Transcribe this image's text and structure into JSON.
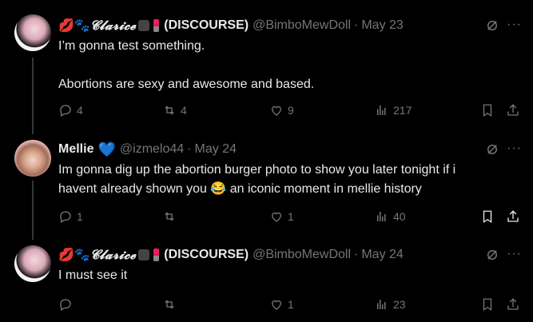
{
  "tweets": [
    {
      "name_prefix": "💋🐾",
      "name_text": "𝓒𝓵𝓪𝓻𝓲𝓬𝓮",
      "name_suffix": "(DISCOURSE)",
      "handle": "@BimboMewDoll",
      "date": "May 23",
      "lines": [
        "I’m gonna test something.",
        "Abortions are sexy and awesome and based."
      ],
      "replies": "4",
      "reposts": "4",
      "likes": "9",
      "views": "217"
    },
    {
      "name_text": "Mellie",
      "name_emoji": "💙",
      "handle": "@izmelo44",
      "date": "May 24",
      "line1": "Im gonna dig up the abortion burger photo to show you later tonight if i",
      "line2_a": "havent already shown you ",
      "line2_emoji": "😂",
      "line2_b": " an iconic moment in mellie history",
      "replies": "1",
      "reposts": "",
      "likes": "1",
      "views": "40"
    },
    {
      "name_prefix": "💋🐾",
      "name_text": "𝓒𝓵𝓪𝓻𝓲𝓬𝓮",
      "name_suffix": "(DISCOURSE)",
      "handle": "@BimboMewDoll",
      "date": "May 24",
      "line1": "I must see it",
      "replies": "",
      "reposts": "",
      "likes": "1",
      "views": "23"
    }
  ],
  "ui": {
    "more": "···",
    "sep": "·"
  }
}
